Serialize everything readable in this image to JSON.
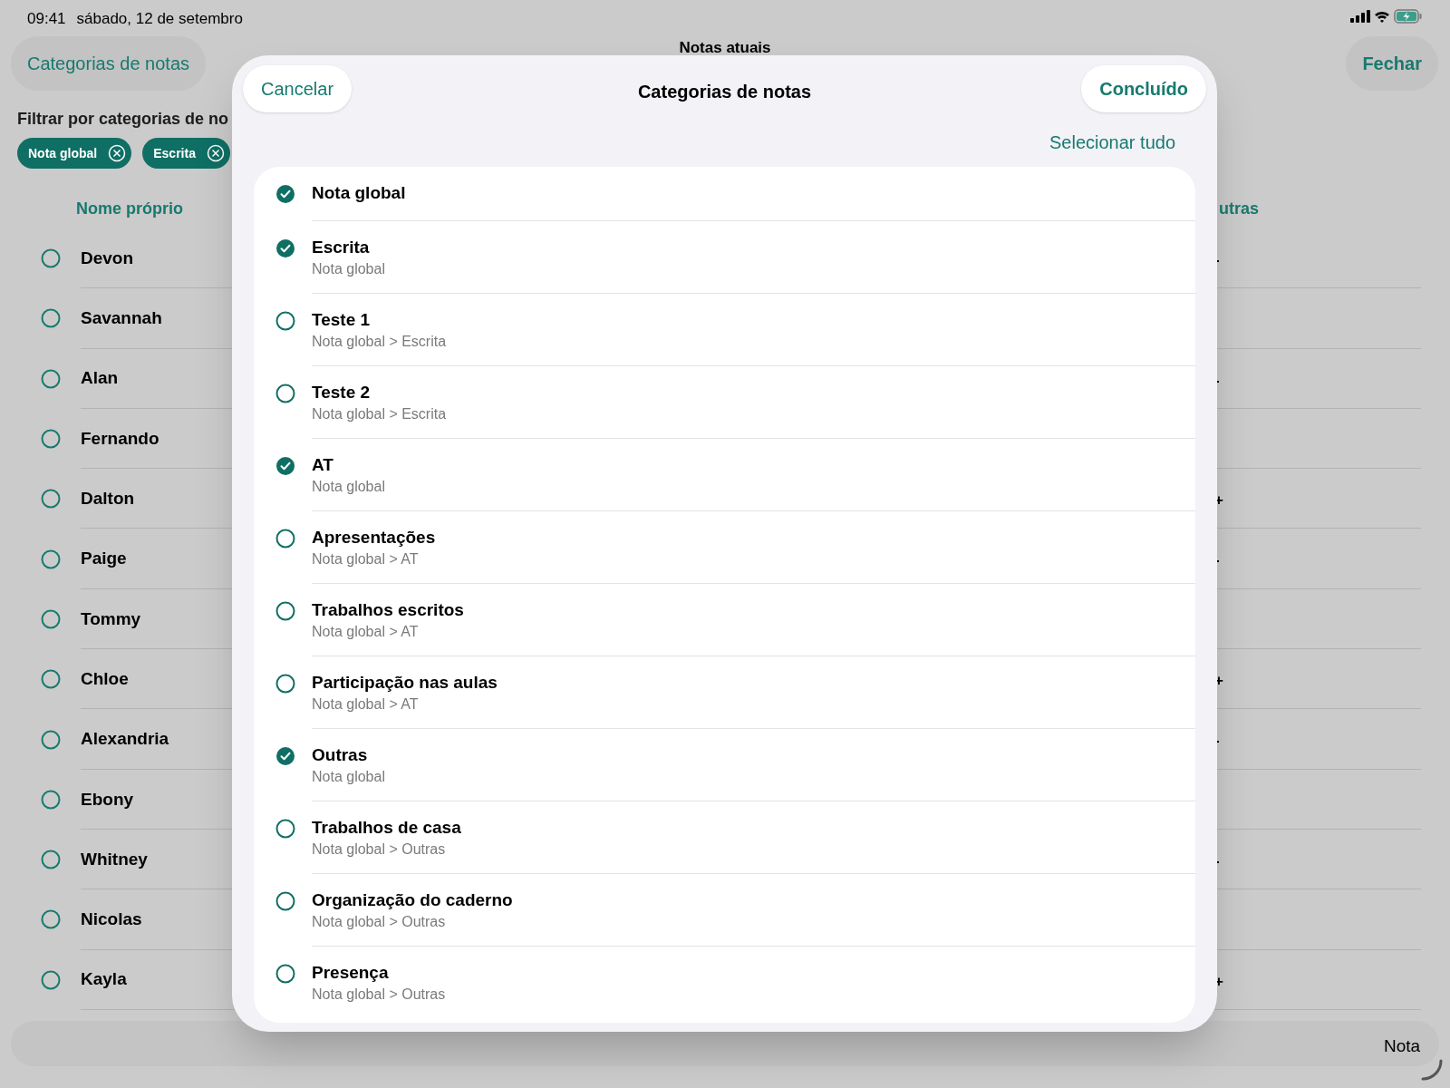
{
  "status_bar": {
    "time": "09:41",
    "date": "sábado, 12 de setembro"
  },
  "background": {
    "back_button": "Categorias de notas",
    "title": "Notas atuais",
    "close_button": "Fechar",
    "filter_label": "Filtrar por categorias de no",
    "chips": [
      "Nota global",
      "Escrita"
    ],
    "name_header": "Nome próprio",
    "other_header": "utras",
    "students": [
      {
        "name": "Devon",
        "mark": "-"
      },
      {
        "name": "Savannah"
      },
      {
        "name": "Alan",
        "mark": "-"
      },
      {
        "name": "Fernando"
      },
      {
        "name": "Dalton",
        "mark": "+"
      },
      {
        "name": "Paige",
        "mark": "-"
      },
      {
        "name": "Tommy"
      },
      {
        "name": "Chloe",
        "mark": "+"
      },
      {
        "name": "Alexandria",
        "mark": "-"
      },
      {
        "name": "Ebony"
      },
      {
        "name": "Whitney",
        "mark": "-"
      },
      {
        "name": "Nicolas"
      },
      {
        "name": "Kayla",
        "mark": "+"
      }
    ],
    "bottom_label": "Nota"
  },
  "sheet": {
    "cancel": "Cancelar",
    "title": "Categorias de notas",
    "done": "Concluído",
    "select_all": "Selecionar tudo",
    "categories": [
      {
        "name": "Nota global",
        "checked": true
      },
      {
        "name": "Escrita",
        "path": "Nota global",
        "checked": true
      },
      {
        "name": "Teste 1",
        "path": "Nota global > Escrita",
        "checked": false
      },
      {
        "name": "Teste 2",
        "path": "Nota global > Escrita",
        "checked": false
      },
      {
        "name": "AT",
        "path": "Nota global",
        "checked": true
      },
      {
        "name": "Apresentações",
        "path": "Nota global > AT",
        "checked": false
      },
      {
        "name": "Trabalhos escritos",
        "path": "Nota global > AT",
        "checked": false
      },
      {
        "name": "Participação nas aulas",
        "path": "Nota global > AT",
        "checked": false
      },
      {
        "name": "Outras",
        "path": "Nota global",
        "checked": true
      },
      {
        "name": "Trabalhos de casa",
        "path": "Nota global > Outras",
        "checked": false
      },
      {
        "name": "Organização do caderno",
        "path": "Nota global > Outras",
        "checked": false
      },
      {
        "name": "Presença",
        "path": "Nota global > Outras",
        "checked": false
      }
    ]
  }
}
